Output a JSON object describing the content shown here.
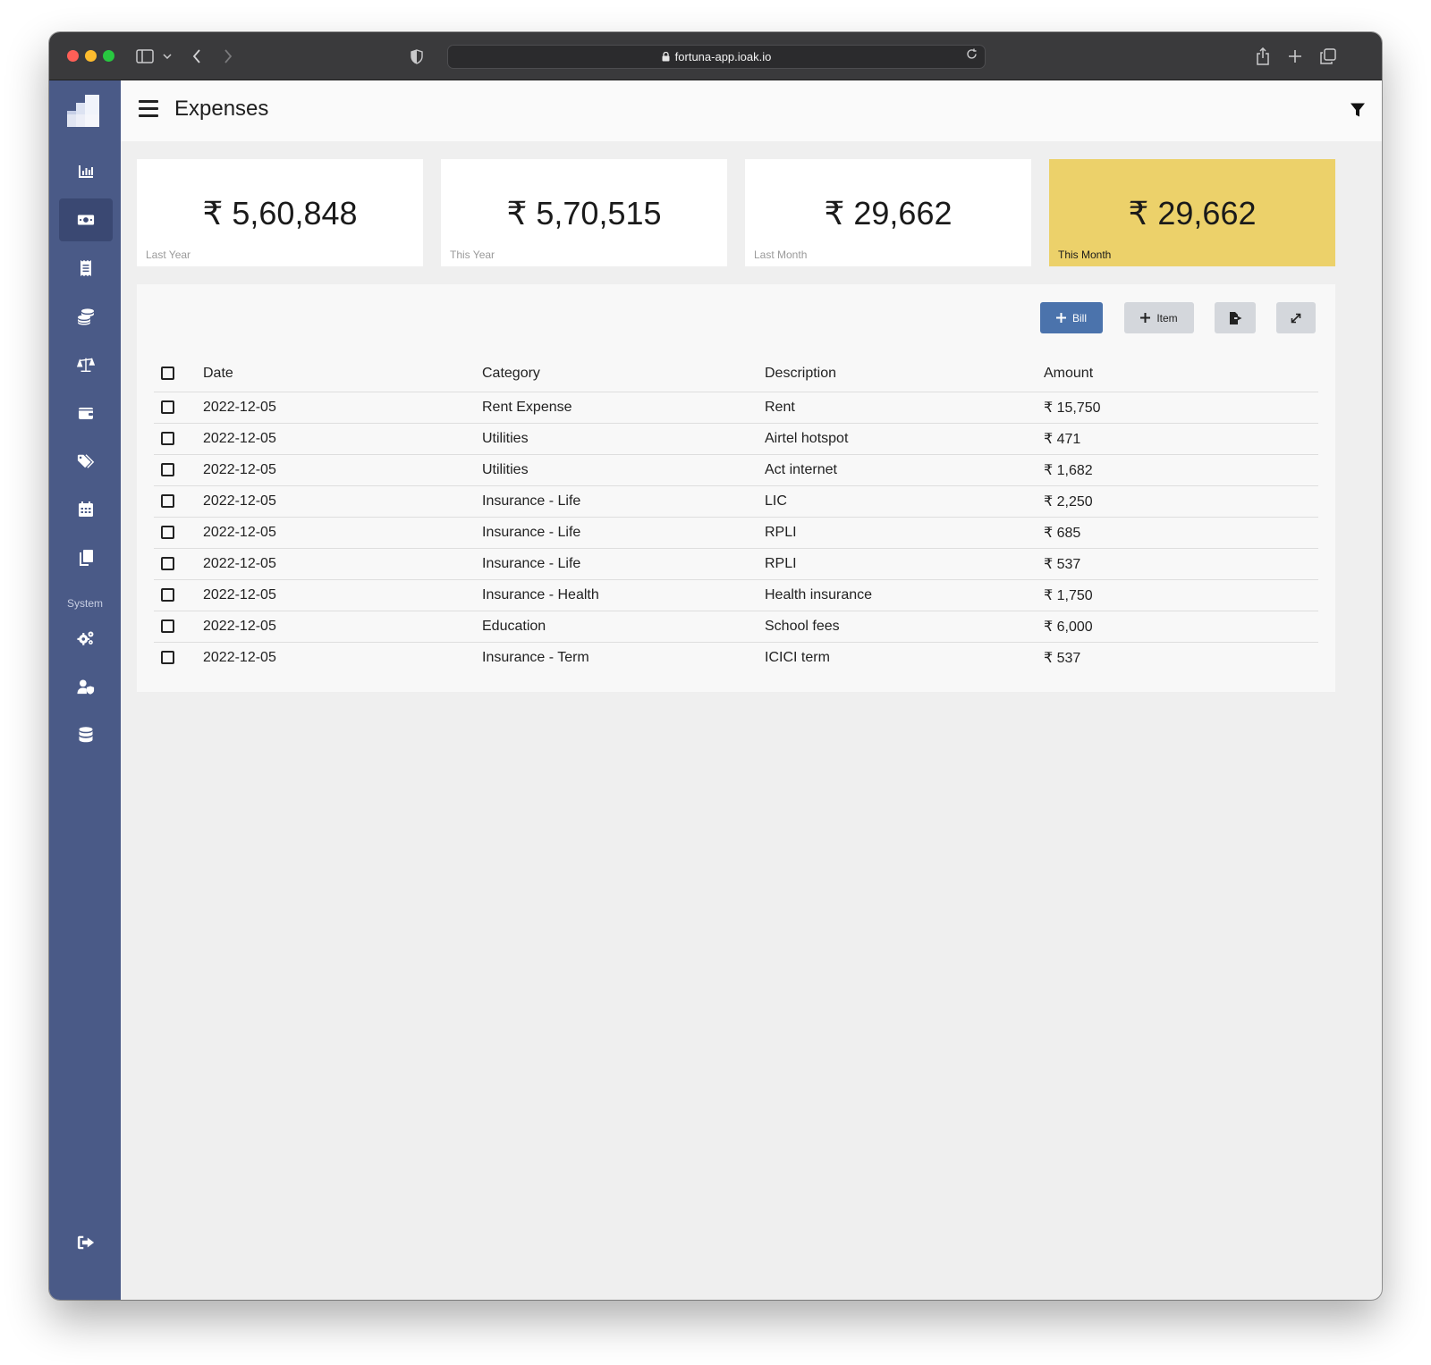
{
  "browser": {
    "url": "fortuna-app.ioak.io"
  },
  "header": {
    "title": "Expenses"
  },
  "sidebar": {
    "system_label": "System",
    "items": [
      {
        "icon": "chart-icon"
      },
      {
        "icon": "money-bill-icon",
        "active": true
      },
      {
        "icon": "receipt-icon"
      },
      {
        "icon": "coins-icon"
      },
      {
        "icon": "balance-scale-icon"
      },
      {
        "icon": "wallet-icon"
      },
      {
        "icon": "tags-icon"
      },
      {
        "icon": "calendar-icon"
      },
      {
        "icon": "copy-icon"
      },
      {
        "icon": "cogs-icon"
      },
      {
        "icon": "user-shield-icon"
      },
      {
        "icon": "database-icon"
      },
      {
        "icon": "sign-out-icon"
      }
    ]
  },
  "stats": [
    {
      "value": "₹ 5,60,848",
      "label": "Last Year"
    },
    {
      "value": "₹ 5,70,515",
      "label": "This Year"
    },
    {
      "value": "₹ 29,662",
      "label": "Last Month"
    },
    {
      "value": "₹ 29,662",
      "label": "This Month",
      "highlight": true
    }
  ],
  "toolbar": {
    "bill_label": "Bill",
    "item_label": "Item"
  },
  "colors": {
    "sidebar": "#4a5a87",
    "highlight": "#ecd16a",
    "primary_button": "#4b73ac"
  },
  "table": {
    "columns": [
      "Date",
      "Category",
      "Description",
      "Amount"
    ],
    "rows": [
      {
        "date": "2022-12-05",
        "category": "Rent Expense",
        "description": "Rent",
        "amount": "₹ 15,750"
      },
      {
        "date": "2022-12-05",
        "category": "Utilities",
        "description": "Airtel hotspot",
        "amount": "₹ 471"
      },
      {
        "date": "2022-12-05",
        "category": "Utilities",
        "description": "Act internet",
        "amount": "₹ 1,682"
      },
      {
        "date": "2022-12-05",
        "category": "Insurance - Life",
        "description": "LIC",
        "amount": "₹ 2,250"
      },
      {
        "date": "2022-12-05",
        "category": "Insurance - Life",
        "description": "RPLI",
        "amount": "₹ 685"
      },
      {
        "date": "2022-12-05",
        "category": "Insurance - Life",
        "description": "RPLI",
        "amount": "₹ 537"
      },
      {
        "date": "2022-12-05",
        "category": "Insurance - Health",
        "description": "Health insurance",
        "amount": "₹ 1,750"
      },
      {
        "date": "2022-12-05",
        "category": "Education",
        "description": "School fees",
        "amount": "₹ 6,000"
      },
      {
        "date": "2022-12-05",
        "category": "Insurance - Term",
        "description": "ICICI term",
        "amount": "₹ 537"
      }
    ]
  }
}
